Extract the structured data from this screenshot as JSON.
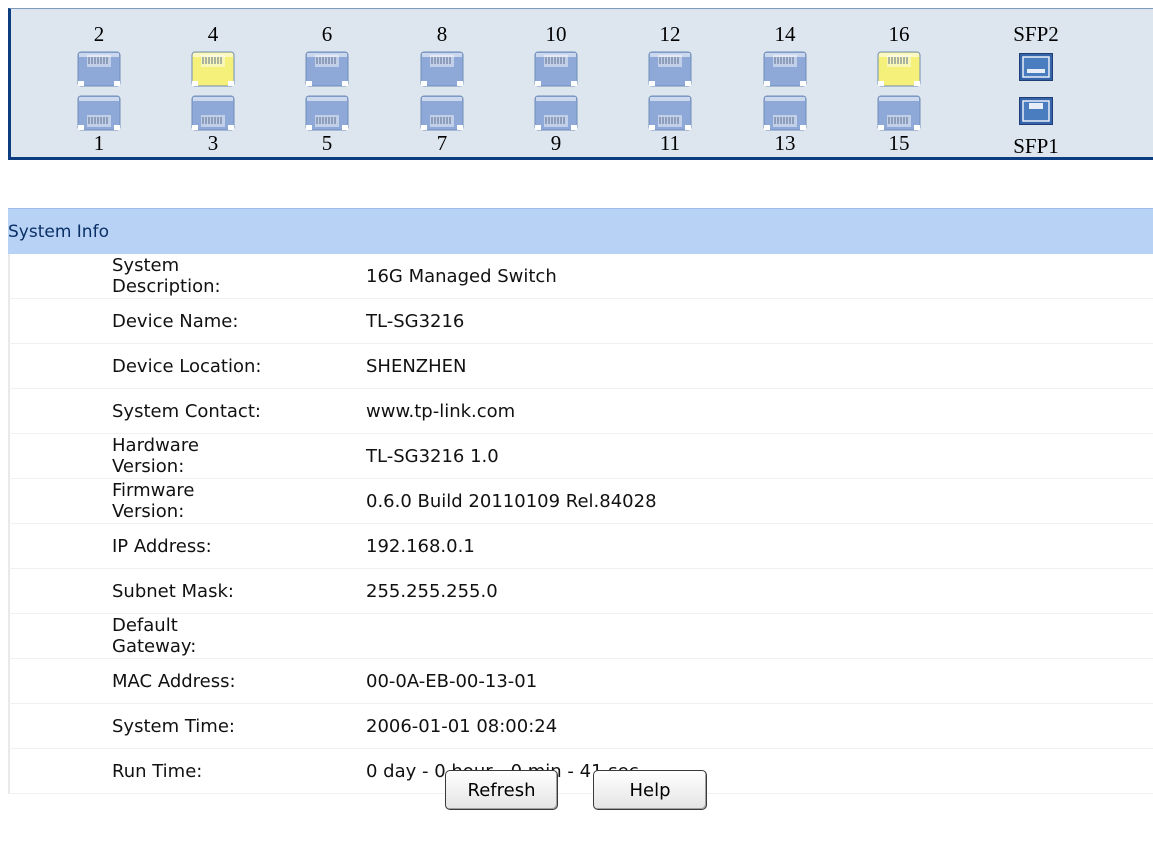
{
  "panel": {
    "top_ports": [
      {
        "num": "2",
        "status": "down"
      },
      {
        "num": "4",
        "status": "up"
      },
      {
        "num": "6",
        "status": "down"
      },
      {
        "num": "8",
        "status": "down"
      },
      {
        "num": "10",
        "status": "down"
      },
      {
        "num": "12",
        "status": "down"
      },
      {
        "num": "14",
        "status": "down"
      },
      {
        "num": "16",
        "status": "up"
      }
    ],
    "bottom_ports": [
      {
        "num": "1",
        "status": "down"
      },
      {
        "num": "3",
        "status": "down"
      },
      {
        "num": "5",
        "status": "down"
      },
      {
        "num": "7",
        "status": "down"
      },
      {
        "num": "9",
        "status": "down"
      },
      {
        "num": "11",
        "status": "down"
      },
      {
        "num": "13",
        "status": "down"
      },
      {
        "num": "15",
        "status": "down"
      }
    ],
    "sfp_top_label": "SFP2",
    "sfp_bottom_label": "SFP1",
    "colors": {
      "link_down": "#8ea8d8",
      "link_up": "#f5f07a",
      "sfp": "#3565a8"
    }
  },
  "sysinfo": {
    "title": "System Info",
    "rows": [
      {
        "label": "System Description:",
        "value": "16G Managed Switch"
      },
      {
        "label": "Device Name:",
        "value": "TL-SG3216"
      },
      {
        "label": "Device Location:",
        "value": "SHENZHEN"
      },
      {
        "label": "System Contact:",
        "value": "www.tp-link.com"
      },
      {
        "label": "Hardware Version:",
        "value": "TL-SG3216 1.0"
      },
      {
        "label": "Firmware Version:",
        "value": "0.6.0 Build 20110109 Rel.84028"
      },
      {
        "label": "IP Address:",
        "value": "192.168.0.1"
      },
      {
        "label": "Subnet Mask:",
        "value": "255.255.255.0"
      },
      {
        "label": "Default Gateway:",
        "value": ""
      },
      {
        "label": "MAC Address:",
        "value": "00-0A-EB-00-13-01"
      },
      {
        "label": "System Time:",
        "value": "2006-01-01 08:00:24"
      },
      {
        "label": "Run Time:",
        "value": "0 day - 0 hour - 0 min - 41 sec"
      }
    ]
  },
  "buttons": {
    "refresh_label": "Refresh",
    "help_label": "Help"
  }
}
